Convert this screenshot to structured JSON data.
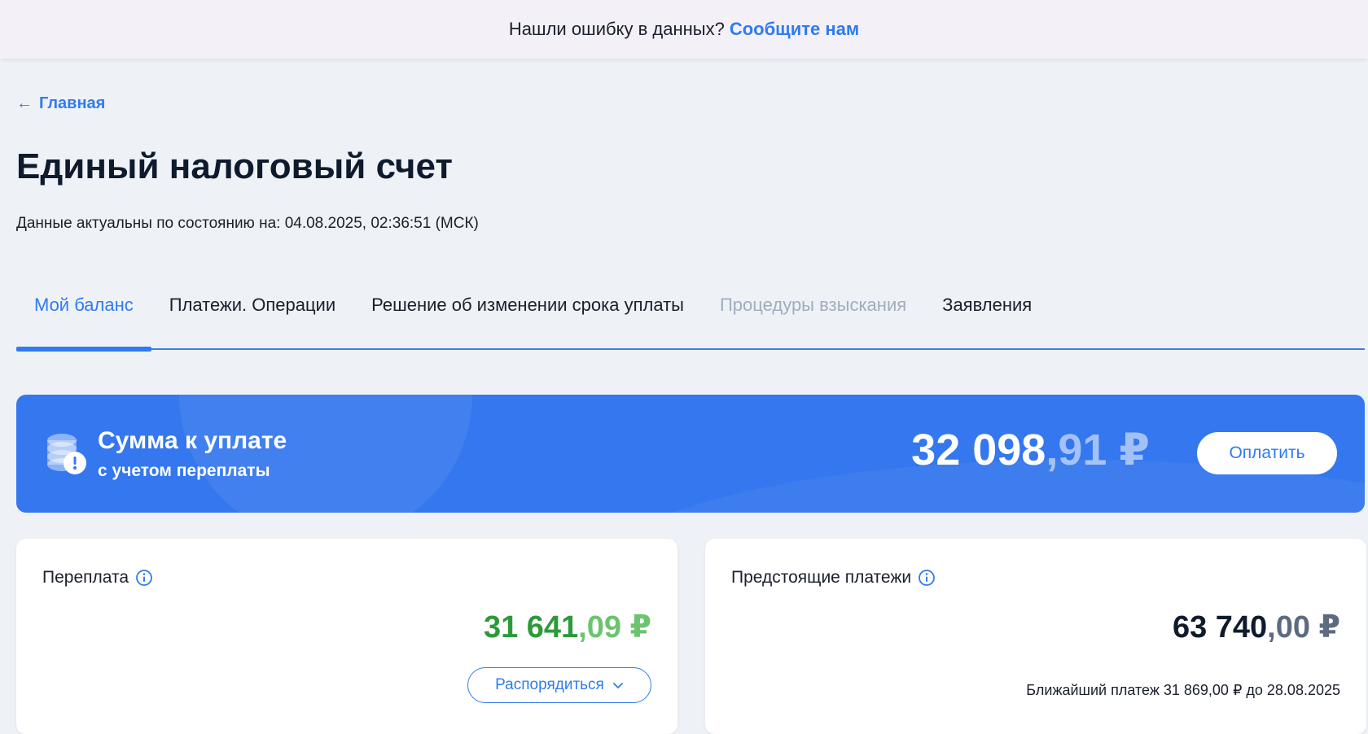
{
  "banner": {
    "text": "Нашли ошибку в данных?",
    "link": "Сообщите нам"
  },
  "breadcrumb": {
    "label": "Главная",
    "icon": "arrow-left-icon"
  },
  "page": {
    "title": "Единый налоговый счет",
    "timestamp": "Данные актуальны по состоянию на: 04.08.2025, 02:36:51 (МСК)"
  },
  "tabs": [
    {
      "label": "Мой баланс",
      "state": "active"
    },
    {
      "label": "Платежи. Операции",
      "state": "normal"
    },
    {
      "label": "Решение об изменении срока уплаты",
      "state": "normal"
    },
    {
      "label": "Процедуры взыскания",
      "state": "disabled"
    },
    {
      "label": "Заявления",
      "state": "normal"
    }
  ],
  "pay_card": {
    "title": "Сумма к уплате",
    "subtitle": "с учетом переплаты",
    "amount_int": "32 098",
    "amount_frac": ",91 ₽",
    "button": "Оплатить",
    "icon": "coins-alert-icon",
    "color": "#3477ee"
  },
  "overpayment": {
    "title": "Переплата",
    "amount_int": "31 641",
    "amount_frac": ",09 ₽",
    "button": "Распорядиться",
    "color": "#2d9a3a"
  },
  "upcoming": {
    "title": "Предстоящие платежи",
    "amount_int": "63 740",
    "amount_frac": ",00 ₽",
    "next_payment": "Ближайший платеж 31 869,00 ₽ до 28.08.2025"
  }
}
